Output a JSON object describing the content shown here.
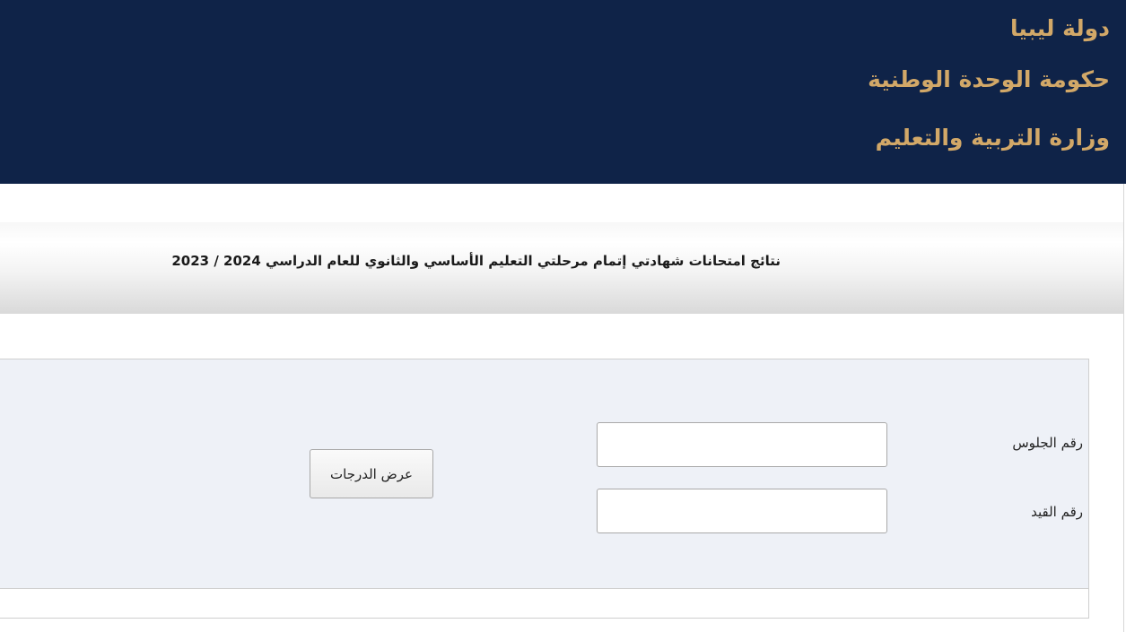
{
  "header": {
    "line1": "دولة ليبيا",
    "line2": "حكومة الوحدة الوطنية",
    "line3": "وزارة التربية والتعليم"
  },
  "title": "نتائج امتحانات شهادتي إتمام مرحلتي التعليم الأساسي والثانوي للعام الدراسي 2024 / 2023",
  "form": {
    "seat_number_label": "رقم الجلوس",
    "seat_number_value": "",
    "registration_number_label": "رقم القيد",
    "registration_number_value": "",
    "submit_label": "عرض الدرجات"
  },
  "colors": {
    "header_bg": "#0f2348",
    "header_text": "#d2a868",
    "panel_bg": "#eef1f7"
  }
}
